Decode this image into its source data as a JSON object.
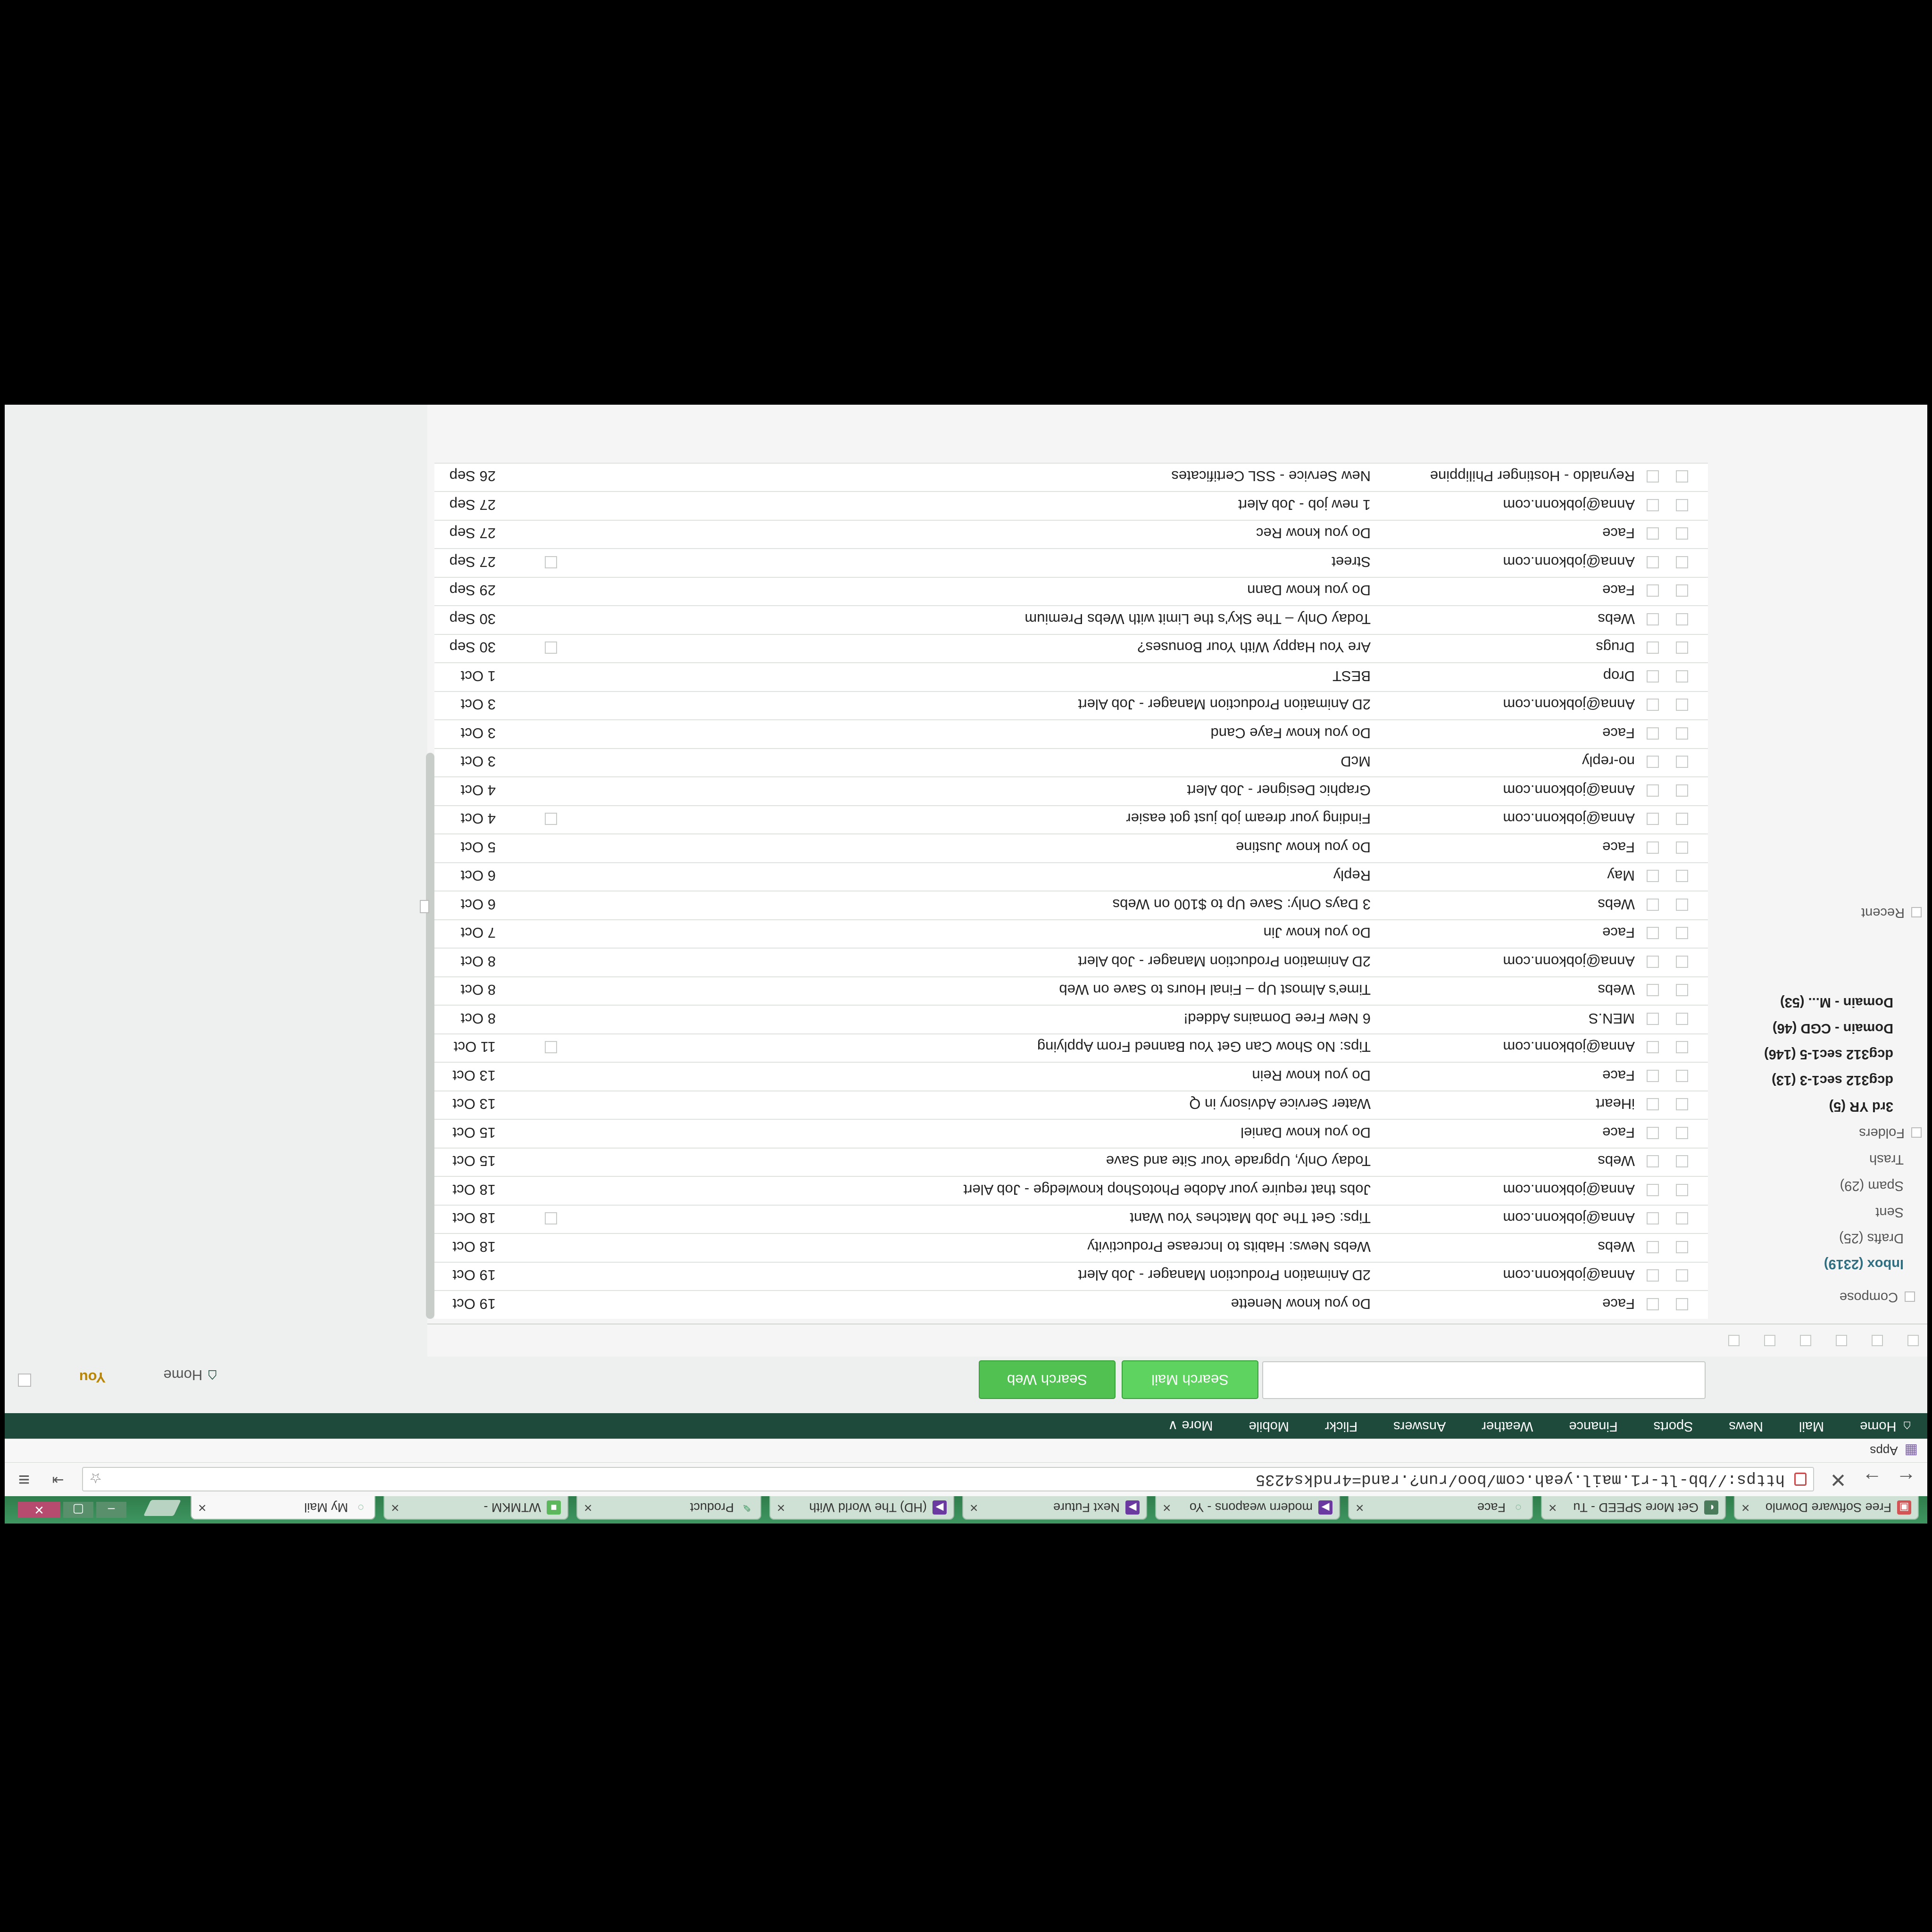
{
  "tabs": [
    {
      "title": "Free Software Downlo",
      "icon": "software-icon"
    },
    {
      "title": "Get More SPEED - Tu",
      "icon": "speed-icon"
    },
    {
      "title": "Face",
      "icon": "loading-icon"
    },
    {
      "title": "modern weapons - Yo",
      "icon": "video-icon"
    },
    {
      "title": "Next Future",
      "icon": "video-icon"
    },
    {
      "title": "(HD) The World With",
      "icon": "video-icon"
    },
    {
      "title": "Product",
      "icon": "product-icon"
    },
    {
      "title": "WTMKM -",
      "icon": "page-icon"
    },
    {
      "title": "My Mail",
      "icon": "loading-icon"
    }
  ],
  "address": {
    "url": "https://bb-lt-r1.mail.yeah.com/boo/run?.rand=4rndks4235"
  },
  "bookmarks": {
    "apps_label": "Apps"
  },
  "topnav": {
    "items": [
      "Home",
      "Mail",
      "News",
      "Sports",
      "Finance",
      "Weather",
      "Answers",
      "Flickr",
      "Mobile",
      "More ∨"
    ]
  },
  "search": {
    "search_mail_label": "Search Mail",
    "search_web_label": "Search Web",
    "home_label": "Home",
    "you_label": "You"
  },
  "sidebar": {
    "compose": "Compose",
    "inbox": "Inbox (2319)",
    "drafts": "Drafts (25)",
    "sent": "Sent",
    "spam": "Spam (29)",
    "trash": "Trash",
    "folders": "Folders",
    "folder_items": [
      "3rd YR (5)",
      "dcg312 sec1-3 (13)",
      "dcg312 sec1-5 (146)",
      "Domain - CGD (46)",
      "Domain - M...    (53)"
    ],
    "recent": "Recent"
  },
  "messages": [
    {
      "from": "Face",
      "subject": "Do you know Nenette",
      "date": "19 Oct",
      "starbox": false
    },
    {
      "from": "Anna@jobkonn.com",
      "subject": "2D Animation Production Manager - Job Alert",
      "date": "19 Oct",
      "starbox": false
    },
    {
      "from": "Webs",
      "subject": "Webs News: Habits to Increase Productivity",
      "date": "18 Oct",
      "starbox": false
    },
    {
      "from": "Anna@jobkonn.com",
      "subject": "Tips: Get The Job Matches You Want",
      "date": "18 Oct",
      "starbox": true
    },
    {
      "from": "Anna@jobkonn.com",
      "subject": "Jobs that require your Adobe PhotoShop knowledge - Job Alert",
      "date": "18 Oct",
      "starbox": false
    },
    {
      "from": "Webs",
      "subject": "Today Only, Upgrade Your Site and Save",
      "date": "15 Oct",
      "starbox": false
    },
    {
      "from": "Face",
      "subject": "Do you know Daniel",
      "date": "15 Oct",
      "starbox": false
    },
    {
      "from": "iHeart",
      "subject": "Water Service Advisory in Q",
      "date": "13 Oct",
      "starbox": false
    },
    {
      "from": "Face",
      "subject": "Do you know Rein",
      "date": "13 Oct",
      "starbox": false
    },
    {
      "from": "Anna@jobkonn.com",
      "subject": "Tips: No Show Can Get You Banned From Applying",
      "date": "11 Oct",
      "starbox": true
    },
    {
      "from": "MEN.S",
      "subject": "6 New Free Domains Added!",
      "date": "8 Oct",
      "starbox": false
    },
    {
      "from": "Webs",
      "subject": "Time's Almost Up – Final Hours to Save on Web",
      "date": "8 Oct",
      "starbox": false
    },
    {
      "from": "Anna@jobkonn.com",
      "subject": "2D Animation Production Manager - Job Alert",
      "date": "8 Oct",
      "starbox": false
    },
    {
      "from": "Face",
      "subject": "Do you know Jin",
      "date": "7 Oct",
      "starbox": false
    },
    {
      "from": "Webs",
      "subject": "3 Days Only: Save Up to $100 on Webs",
      "date": "6 Oct",
      "starbox": false
    },
    {
      "from": "May",
      "subject": "Reply",
      "date": "6 Oct",
      "starbox": false
    },
    {
      "from": "Face",
      "subject": "Do you know Justine",
      "date": "5 Oct",
      "starbox": false
    },
    {
      "from": "Anna@jobkonn.com",
      "subject": "Finding your dream job just got easier",
      "date": "4 Oct",
      "starbox": true
    },
    {
      "from": "Anna@jobkonn.com",
      "subject": "Graphic Designer - Job Alert",
      "date": "4 Oct",
      "starbox": false
    },
    {
      "from": "no-reply",
      "subject": "McD",
      "date": "3 Oct",
      "starbox": false
    },
    {
      "from": "Face",
      "subject": "Do you know Faye Cand",
      "date": "3 Oct",
      "starbox": false
    },
    {
      "from": "Anna@jobkonn.com",
      "subject": "2D Animation Production Manager - Job Alert",
      "date": "3 Oct",
      "starbox": false
    },
    {
      "from": "Drop",
      "subject": "BEST",
      "date": "1 Oct",
      "starbox": false
    },
    {
      "from": "Drugs",
      "subject": "Are You Happy With Your Bonuses?",
      "date": "30 Sep",
      "starbox": true
    },
    {
      "from": "Webs",
      "subject": "Today Only – The Sky's the Limit with Webs Premium",
      "date": "30 Sep",
      "starbox": false
    },
    {
      "from": "Face",
      "subject": "Do you know Dann",
      "date": "29 Sep",
      "starbox": false
    },
    {
      "from": "Anna@jobkonn.com",
      "subject": "Street",
      "date": "27 Sep",
      "starbox": true
    },
    {
      "from": "Face",
      "subject": "Do you know Rec",
      "date": "27 Sep",
      "starbox": false
    },
    {
      "from": "Anna@jobkonn.com",
      "subject": "1 new job - Job Alert",
      "date": "27 Sep",
      "starbox": false
    },
    {
      "from": "Reynaldo - Hostinger Philippine",
      "subject": "New Service - SSL Certificates",
      "date": "26 Sep",
      "starbox": false
    }
  ],
  "colors": {
    "nav_bg": "#1d4a3a",
    "accent_green": "#51c252",
    "inbox_link": "#2e6f82",
    "you_link": "#b8860b"
  }
}
